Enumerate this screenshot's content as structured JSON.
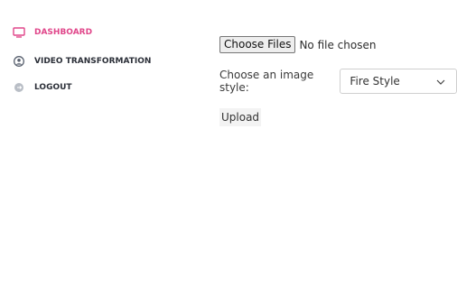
{
  "sidebar": {
    "items": [
      {
        "label": "DASHBOARD",
        "icon": "monitor-icon",
        "active": true
      },
      {
        "label": "VIDEO TRANSFORMATION",
        "icon": "user-circle-icon",
        "active": false
      },
      {
        "label": "LOGOUT",
        "icon": "logout-icon",
        "active": false
      }
    ]
  },
  "main": {
    "file_input": {
      "button_label": "Choose Files",
      "status_text": "No file chosen"
    },
    "style_select": {
      "label": "Choose an image style:",
      "selected": "Fire Style"
    },
    "upload_label": "Upload"
  },
  "colors": {
    "accent": "#e0468a",
    "nav_text": "#2b2f38"
  }
}
